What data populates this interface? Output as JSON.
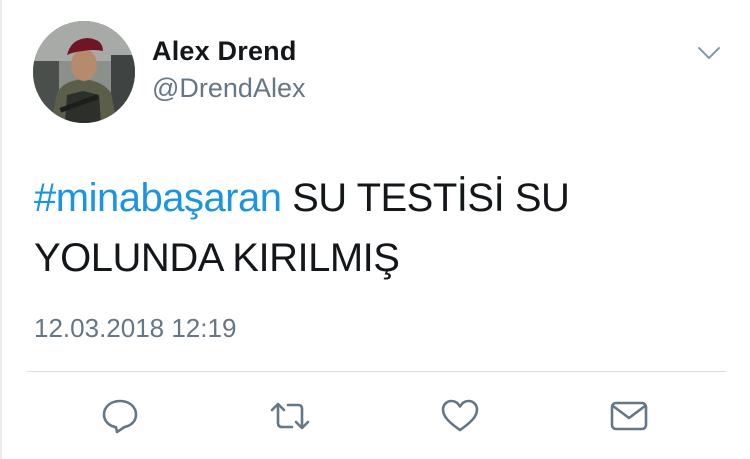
{
  "tweet": {
    "author": {
      "display_name": "Alex Drend",
      "handle": "@DrendAlex",
      "avatar_icon": "profile-photo"
    },
    "text": {
      "hashtag": "#minabaşaran",
      "body": " SU TESTİSİ SU YOLUNDA KIRILMIŞ"
    },
    "timestamp": "12.03.2018 12:19",
    "menu_icon": "chevron-down-icon",
    "actions": {
      "reply_icon": "reply-icon",
      "retweet_icon": "retweet-icon",
      "like_icon": "heart-icon",
      "dm_icon": "envelope-icon"
    }
  },
  "colors": {
    "hashtag": "#1b95e0",
    "secondary_text": "#657786",
    "icon": "#657786",
    "primary_text": "#14171a",
    "divider": "#d7dde2"
  }
}
